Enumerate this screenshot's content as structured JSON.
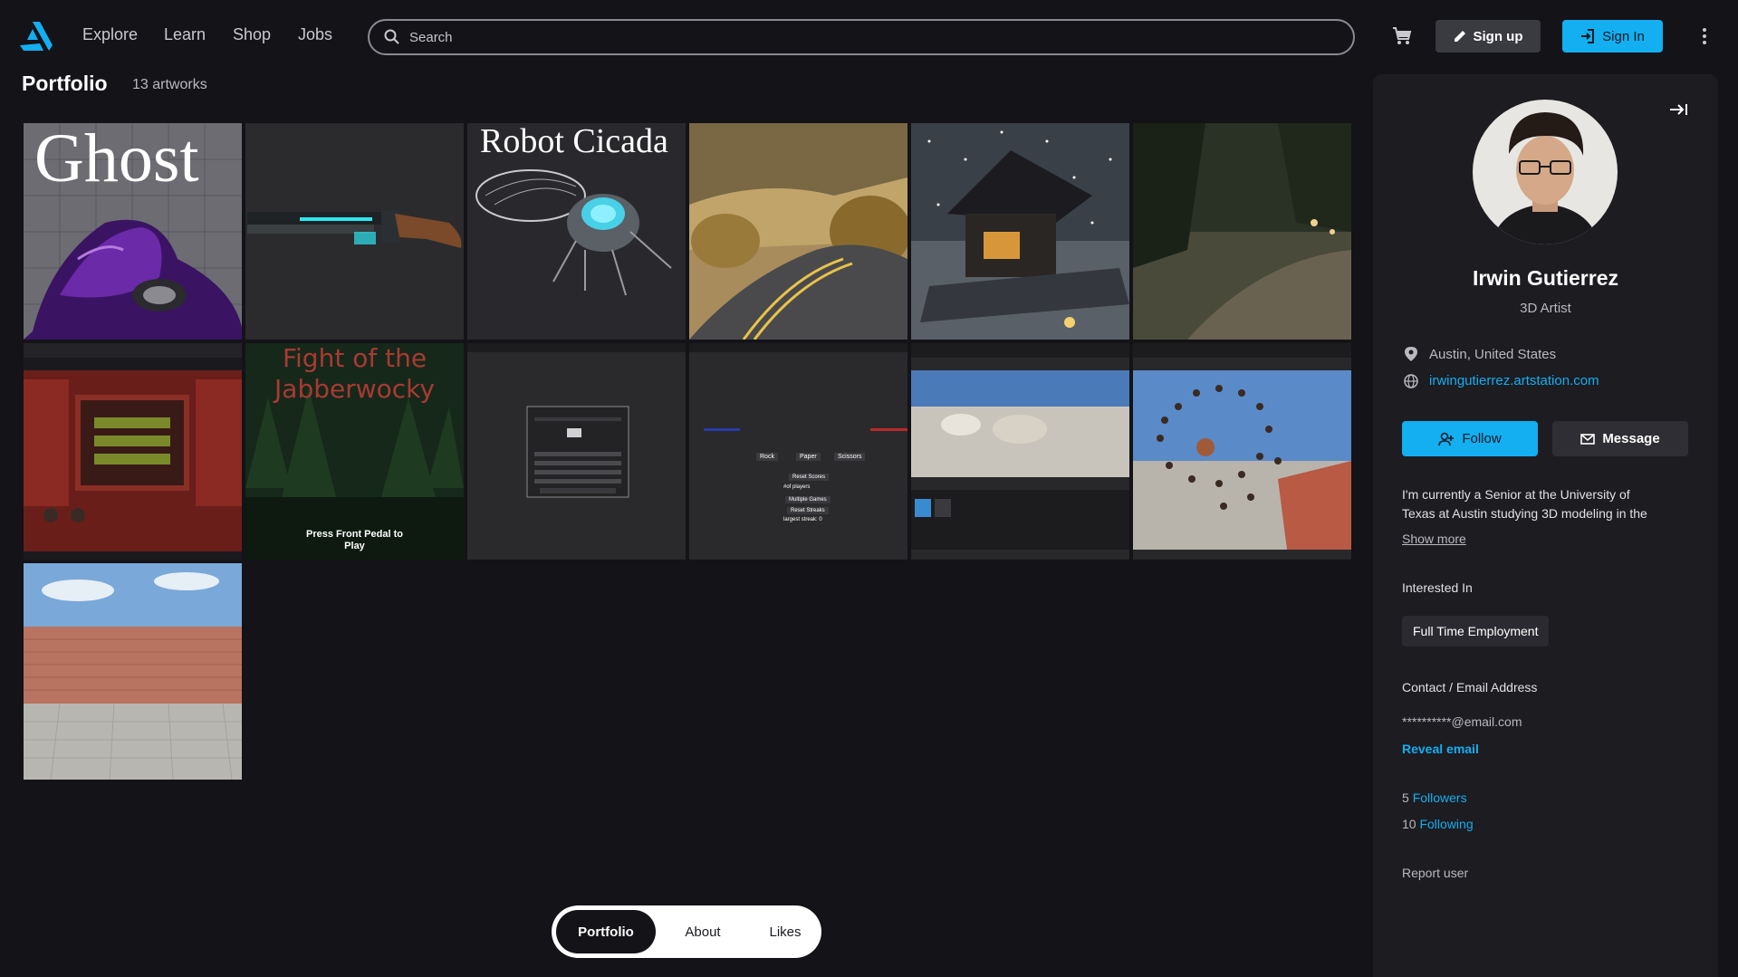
{
  "nav": {
    "items": [
      "Explore",
      "Learn",
      "Shop",
      "Jobs"
    ],
    "search_placeholder": "Search",
    "signup_label": "Sign up",
    "signin_label": "Sign In",
    "icons": {
      "logo": "artstation-logo-icon",
      "search": "search-icon",
      "cart": "cart-icon",
      "pencil": "pencil-icon",
      "signin": "sign-in-icon",
      "more": "more-vertical-icon"
    }
  },
  "portfolio": {
    "title": "Portfolio",
    "count_label": "13 artworks",
    "tiles": [
      {
        "name": "artwork-ghost",
        "caption": "Ghost"
      },
      {
        "name": "artwork-shotgun",
        "caption": ""
      },
      {
        "name": "artwork-robot-cicada",
        "caption": "Robot Cicada"
      },
      {
        "name": "artwork-desert-road",
        "caption": ""
      },
      {
        "name": "artwork-snow-pavilion",
        "caption": ""
      },
      {
        "name": "artwork-night-forest",
        "caption": ""
      },
      {
        "name": "artwork-red-machine",
        "caption": ""
      },
      {
        "name": "artwork-jabberwocky",
        "caption": "Fight of the Jabberwocky",
        "caption_lines": [
          "Fight of the",
          "Jabberwocky"
        ],
        "subcaption_lines": [
          "Press Front Pedal to",
          "Play"
        ]
      },
      {
        "name": "artwork-fracture-tool",
        "caption": ""
      },
      {
        "name": "artwork-rock-paper-scissors",
        "caption": "",
        "buttons": [
          "Rock",
          "Paper",
          "Scissors"
        ],
        "menu": [
          "Reset Scores",
          "#of players",
          "Multiple Games",
          "Reset Streaks",
          "largest streak: 0"
        ]
      },
      {
        "name": "artwork-editor-animals",
        "caption": ""
      },
      {
        "name": "artwork-orb-spiral",
        "caption": ""
      },
      {
        "name": "artwork-brick-wall",
        "caption": ""
      }
    ]
  },
  "profile": {
    "name": "Irwin Gutierrez",
    "role": "3D Artist",
    "location": "Austin, United States",
    "website": "irwingutierrez.artstation.com",
    "follow_label": "Follow",
    "message_label": "Message",
    "bio_lines": [
      "I'm currently a Senior at the University of",
      "Texas at Austin studying 3D modeling in the"
    ],
    "show_more": "Show more",
    "interested_label": "Interested In",
    "interest": "Full Time Employment",
    "contact_label": "Contact / Email Address",
    "email_masked": "**********@email.com",
    "reveal_email": "Reveal email",
    "followers_count": "5",
    "followers_label": "Followers",
    "following_count": "10",
    "following_label": "Following",
    "report_label": "Report user"
  },
  "tabs": {
    "items": [
      "Portfolio",
      "About",
      "Likes"
    ],
    "active": "Portfolio"
  },
  "colors": {
    "background": "#131318",
    "sidebar": "#1c1c21",
    "accent": "#13aff0"
  }
}
